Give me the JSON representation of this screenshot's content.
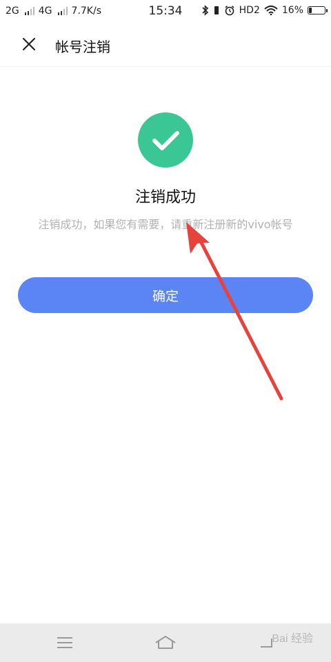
{
  "status_bar": {
    "net1": "2G",
    "net2": "4G",
    "speed": "7.7K/s",
    "time": "15:34",
    "hd": "HD2",
    "battery": "16%"
  },
  "header": {
    "title": "帐号注销"
  },
  "result": {
    "title": "注销成功",
    "description": "注销成功，如果您有需要，请重新注册新的vivo帐号",
    "confirm_label": "确定"
  },
  "watermark": {
    "text": "Bai 经验"
  },
  "colors": {
    "success_green": "#3bc696",
    "button_blue": "#5b85f5",
    "annotation_red": "#e8423c"
  }
}
